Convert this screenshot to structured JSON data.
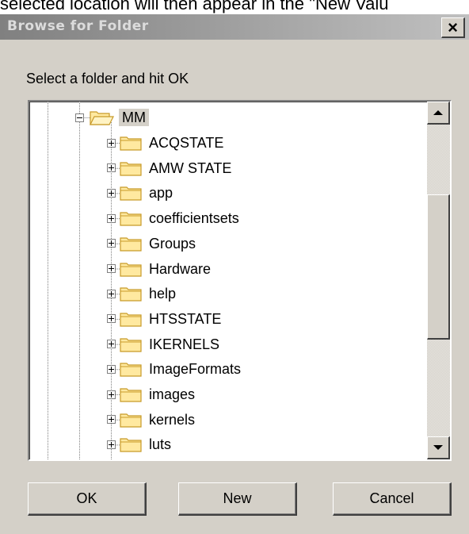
{
  "background_text": "selected location will then appear in the \"New Valu",
  "dialog": {
    "title": "Browse for Folder",
    "close_label": "×",
    "instruction": "Select a folder and hit OK"
  },
  "tree": {
    "root": {
      "label": "MM",
      "expanded": true,
      "selected": true
    },
    "children": [
      "ACQSTATE",
      "AMW STATE",
      "app",
      "coefficientsets",
      "Groups",
      "Hardware",
      "help",
      "HTSSTATE",
      "IKERNELS",
      "ImageFormats",
      "images",
      "kernels",
      "luts"
    ]
  },
  "buttons": {
    "ok": "OK",
    "new": "New",
    "cancel": "Cancel"
  },
  "colors": {
    "dialog_bg": "#d4d0c8",
    "titlebar_start": "#808080",
    "folder_fill": "#ffe9a0",
    "folder_edge": "#c89a28"
  },
  "icons": {
    "folder": "folder-icon",
    "expander_collapsed": "plus-box-icon",
    "expander_expanded": "minus-box-icon",
    "scroll_up": "triangle-up-icon",
    "scroll_down": "triangle-down-icon",
    "close": "close-x-icon"
  }
}
